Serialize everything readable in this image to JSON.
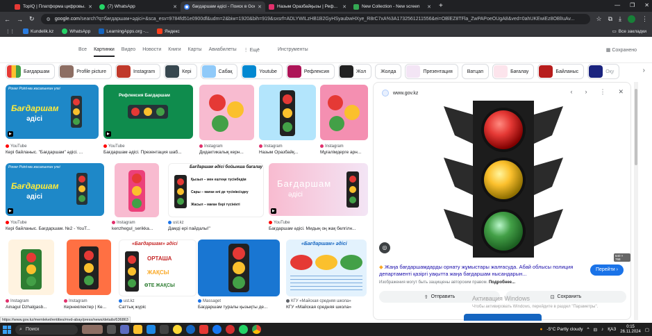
{
  "browser": {
    "tabs": [
      {
        "title": "TopIQ | Платформа цифровы...",
        "color": "#e53935",
        "active": false
      },
      {
        "title": "(7) WhatsApp",
        "color": "#25d366",
        "active": false
      },
      {
        "title": "бағдаршам әдісі - Поиск в Goo...",
        "color": "#4285f4",
        "active": true
      },
      {
        "title": "Назым Оразбайқызы | Реф...",
        "color": "#e1306c",
        "active": false
      },
      {
        "title": "New Collection - New screen",
        "color": "#34a853",
        "active": false
      }
    ],
    "new_tab": "+",
    "url_host": "google.com",
    "url_rest": "/search?q=бағдаршам+әдісі+&sca_esv=9784fd51e0900df&udm=2&biw=1920&bih=919&sxsrf=ADLYWILzHB1B2GyHSyaubwHXye_R8rC7xA%3A1732561211556&ei=OBlEZ8TFla_ZwPAPoeOUgA8&ved=0ahUKEwiEz8OBlIuAv...",
    "bookmarks": [
      {
        "label": "Kundelik.kz",
        "color": "#2a7de1"
      },
      {
        "label": "WhatsApp",
        "color": "#25d366"
      },
      {
        "label": "LearningApps.org -...",
        "color": "#1565c0"
      },
      {
        "label": "Яндекс",
        "color": "#fc3f1d"
      }
    ],
    "all_bookmarks": "Все закладки"
  },
  "google": {
    "nav_tabs": [
      "Все",
      "Картинки",
      "Видео",
      "Новости",
      "Книги",
      "Карты",
      "Авиабилеты",
      "⋮ Ещё",
      "Инструменты"
    ],
    "active_tab": "Картинки",
    "saved": "Сохранено",
    "chips": [
      "Бағдаршам",
      "Profile picture",
      "Instagram",
      "Кері",
      "Сабақ",
      "Youtube",
      "Рефлексия",
      "Жол",
      "Жолда",
      "Презентация",
      "Ватцап",
      "Бағалау",
      "Байланыс",
      "Оқу"
    ]
  },
  "results": [
    {
      "src": "YouTube",
      "src_color": "#ff0000",
      "caption": "Кері байланыс. \"Бағдаршам\" әдісі. ..."
    },
    {
      "src": "YouTube",
      "src_color": "#ff0000",
      "caption": "Бағдаршам әдісі. Презентация шаб..."
    },
    {
      "src": "Instagram",
      "src_color": "#e1306c",
      "caption": "Дидактикалық керн..."
    },
    {
      "src": "Instagram",
      "src_color": "#e1306c",
      "caption": "Назым Оразбайқ..."
    },
    {
      "src": "Instagram",
      "src_color": "#e1306c",
      "caption": "Мұғалімдерге арн..."
    },
    {
      "src": "YouTube",
      "src_color": "#ff0000",
      "caption": "Кері байланыс. Бағдаршам. №2 - YouT..."
    },
    {
      "src": "Instagram",
      "src_color": "#e1306c",
      "caption": "kenzhegul_serikka..."
    },
    {
      "src": "ust.kz",
      "src_color": "#1a73e8",
      "caption": "Дамді ері пайдалы!\""
    },
    {
      "src": "YouTube",
      "src_color": "#ff0000",
      "caption": "Бағдаршам әдісі. Мидың оң жақ белгілн..."
    },
    {
      "src": "Instagram",
      "src_color": "#e1306c",
      "caption": "Ainagul Dzhalgasb..."
    },
    {
      "src": "Instagram",
      "src_color": "#e1306c",
      "caption": "Кернекілектер | Ке..."
    },
    {
      "src": "ust.kz",
      "src_color": "#1a73e8",
      "caption": "Саттық жүріс"
    },
    {
      "src": "Massaget",
      "src_color": "#1a73e8",
      "caption": "Бағдаршам туралы қызықты де..."
    },
    {
      "src": "КГУ «Майская средняя школа»",
      "src_color": "#5f6368",
      "caption": "КГУ «Майская средняя школа»"
    }
  ],
  "image_text": {
    "ppt": "Power Point-ма жасалынған үлгі",
    "bagdarsham": "Бағдаршам",
    "adisi": "әдісі",
    "refleksiya": "Рефлексия Бағдаршам",
    "method_title": "Бағдаршам әдісі бойынша бағалау",
    "red_line": "Қызыл – мен ештеңе түсінбедім",
    "yellow_line": "Сары – маған әлі де түсініксіздеу",
    "green_line": "Жасыл – маған бәрі түсінікті",
    "quoted": "«Бағдаршам» әдісі",
    "ortasha": "ОРТАША",
    "zhaksy": "ЖАҚСЫ",
    "ote": "ӨТЕ ЖАҚСЫ"
  },
  "panel": {
    "site": "www.gov.kz",
    "title": "Жаңа бағдаршамдарды орнату жұмыстары жалғасуда. Абай облысы полиция департаменті қазіргі уақытта жаңа бағдаршам нысандарын...",
    "note": "Изображения могут быть защищены авторским правом.",
    "more": "Подробнее...",
    "go": "Перейти",
    "share": "Отправить",
    "save": "Сохранить",
    "size": "640 × 768"
  },
  "activation": {
    "title": "Активация Windows",
    "sub": "Чтобы активировать Windows, перейдите в раздел \"Параметры\"."
  },
  "status_url": "https://www.gov.kz/memleket/entities/mvd-abay/press/news/details/636863",
  "taskbar": {
    "search": "Поиск",
    "weather": "-5°C Partly cloudy",
    "lang": "ҚАЗ",
    "time": "0:15",
    "date": "26.11.2024"
  }
}
